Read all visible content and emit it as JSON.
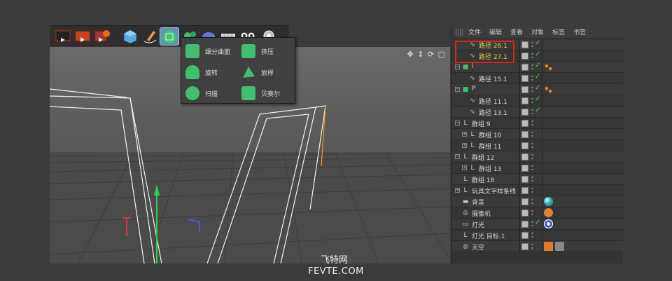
{
  "toolbar": {
    "buttons": [
      {
        "icon": "render-region-icon"
      },
      {
        "icon": "render-view-icon"
      },
      {
        "icon": "render-settings-icon"
      },
      {
        "icon": "cube-primitive-icon"
      },
      {
        "icon": "pen-spline-icon"
      },
      {
        "icon": "subdivision-generator-icon",
        "active": true
      },
      {
        "icon": "array-icon"
      },
      {
        "icon": "deformer-icon"
      },
      {
        "icon": "floor-icon"
      },
      {
        "icon": "camera-icon"
      },
      {
        "icon": "light-icon"
      }
    ]
  },
  "popup": {
    "items": [
      {
        "label": "细分曲面",
        "icon": "subdivision-surface-icon",
        "color": "#3fbf6f"
      },
      {
        "label": "挤压",
        "icon": "extrude-icon",
        "color": "#3fbf6f"
      },
      {
        "label": "旋转",
        "icon": "lathe-icon",
        "color": "#3fbf6f"
      },
      {
        "label": "放样",
        "icon": "loft-icon",
        "color": "#3fbf6f"
      },
      {
        "label": "扫描",
        "icon": "sweep-icon",
        "color": "#3fbf6f"
      },
      {
        "label": "贝赛尔",
        "icon": "bezier-icon",
        "color": "#3fbf6f"
      }
    ]
  },
  "object_manager": {
    "menu": [
      "文件",
      "编辑",
      "查看",
      "对象",
      "标签",
      "书签"
    ],
    "rows": [
      {
        "name": "路径 26.1",
        "icon": "spline-icon",
        "highlight": true,
        "check": true,
        "tags": []
      },
      {
        "name": "路径 27.1",
        "icon": "spline-icon",
        "highlight": true,
        "check": true,
        "tags": []
      },
      {
        "name": "i",
        "icon": "extrude-icon",
        "check": true,
        "expander": "−",
        "tags": [
          "phong-tag-icon"
        ]
      },
      {
        "name": "路径 15.1",
        "icon": "spline-icon",
        "check": true,
        "tags": []
      },
      {
        "name": "P",
        "icon": "extrude-icon",
        "check": true,
        "expander": "−",
        "tags": [
          "phong-tag-icon"
        ]
      },
      {
        "name": "路径 11.1",
        "icon": "spline-icon",
        "check": true,
        "tags": []
      },
      {
        "name": "路径 13.1",
        "icon": "spline-icon",
        "check": true,
        "tags": []
      },
      {
        "name": "群组 9",
        "icon": "null-group-icon",
        "check": false,
        "expander": "−",
        "tags": []
      },
      {
        "name": "群组 10",
        "icon": "null-group-icon",
        "check": false,
        "expander": "+",
        "tags": []
      },
      {
        "name": "群组 11",
        "icon": "null-group-icon",
        "check": false,
        "expander": "+",
        "tags": []
      },
      {
        "name": "群组 12",
        "icon": "null-group-icon",
        "check": false,
        "expander": "−",
        "tags": []
      },
      {
        "name": "群组 13",
        "icon": "null-group-icon",
        "check": false,
        "expander": "+",
        "tags": []
      },
      {
        "name": "群组 18",
        "icon": "null-group-icon",
        "check": false,
        "tags": []
      },
      {
        "name": "玩具文字样条线",
        "icon": "null-group-icon",
        "check": false,
        "expander": "+",
        "tags": []
      },
      {
        "name": "背景",
        "icon": "background-icon",
        "check": false,
        "tags": [
          "material-sphere-icon"
        ]
      },
      {
        "name": "摄像机",
        "icon": "camera-icon",
        "check": false,
        "tags": [
          "protection-tag-icon"
        ]
      },
      {
        "name": "灯光",
        "icon": "light-icon",
        "check": true,
        "tags": [
          "target-tag-icon"
        ]
      },
      {
        "name": "灯光 目标.1",
        "icon": "null-group-icon",
        "check": false,
        "tags": []
      },
      {
        "name": "天空",
        "icon": "sky-icon",
        "check": false,
        "tags": [
          "sky-tag-icon",
          "hdri-tag-icon"
        ]
      }
    ]
  },
  "watermark": {
    "line1": "飞特网",
    "line2": "FEVTE.COM"
  }
}
